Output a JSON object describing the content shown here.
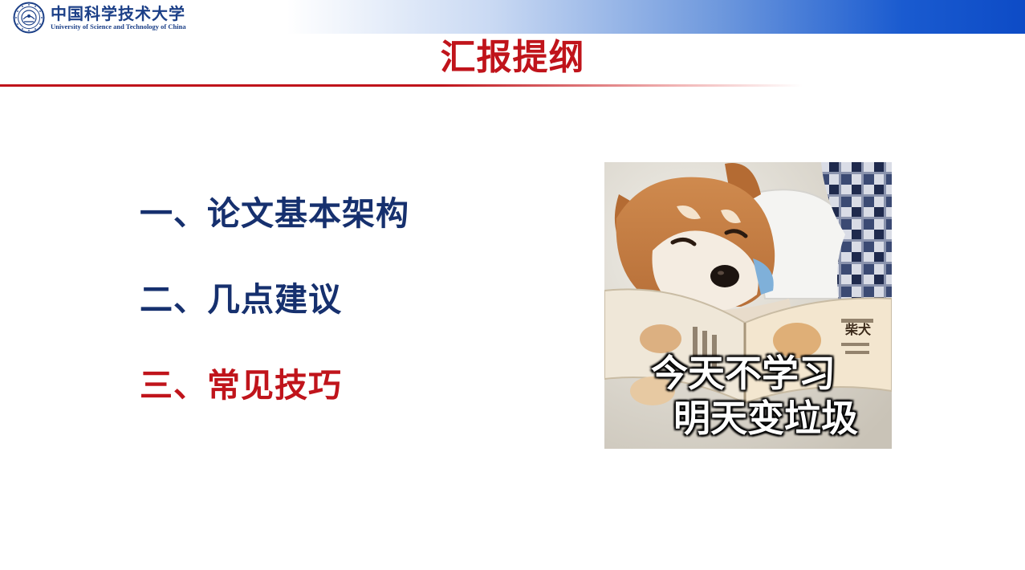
{
  "header": {
    "school_name_cn": "中国科学技术大学",
    "school_name_en": "University of Science and Technology of China"
  },
  "title": "汇报提纲",
  "agenda": [
    {
      "label": "一、论文基本架构",
      "active": false
    },
    {
      "label": "二、几点建议",
      "active": false
    },
    {
      "label": "三、常见技巧",
      "active": true
    }
  ],
  "meme": {
    "caption_line1": "今天不学习",
    "caption_line2": "明天变垃圾",
    "book_title": "柴犬"
  },
  "colors": {
    "accent_red": "#c0141b",
    "navy": "#16306e",
    "banner_blue": "#0d4bc6"
  }
}
